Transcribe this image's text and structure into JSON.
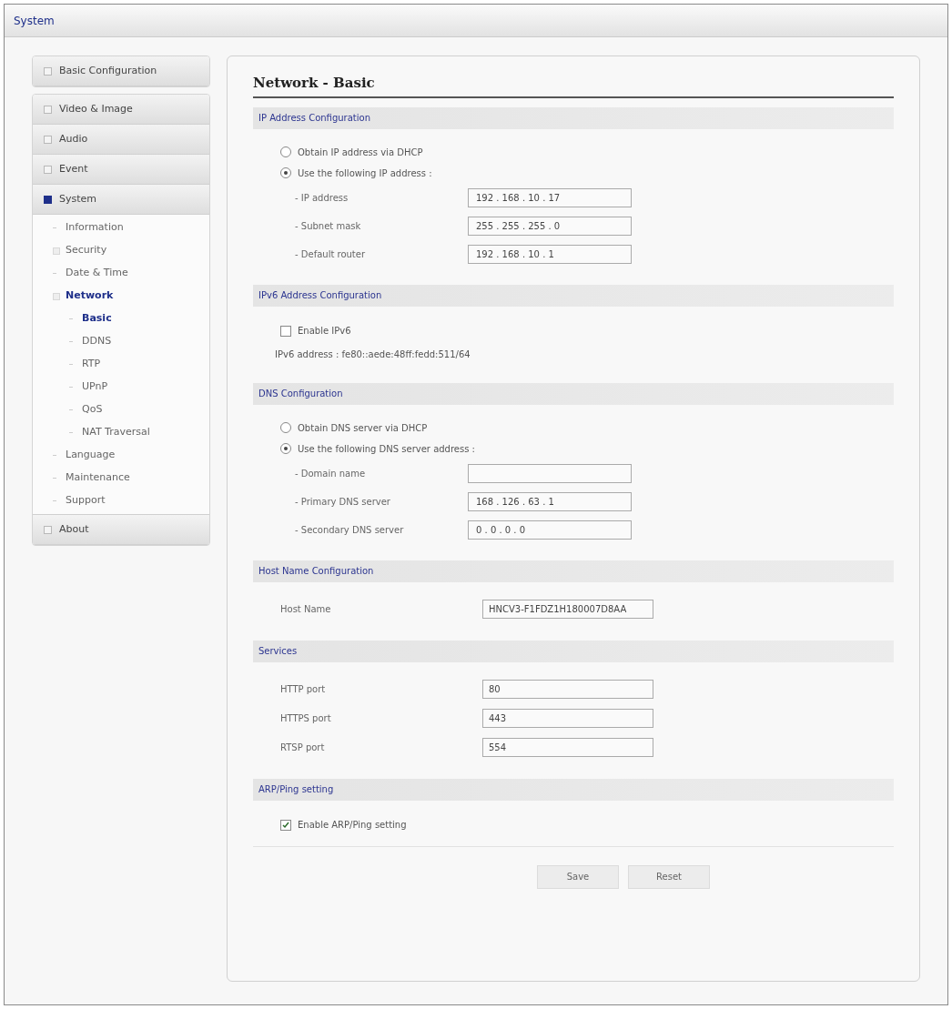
{
  "header": {
    "title": "System"
  },
  "sidebar": {
    "groups": [
      {
        "items": [
          {
            "label": "Basic Configuration",
            "expanded": false
          }
        ]
      },
      {
        "items": [
          {
            "label": "Video & Image",
            "expanded": false
          },
          {
            "label": "Audio",
            "expanded": false
          },
          {
            "label": "Event",
            "expanded": false
          },
          {
            "label": "System",
            "expanded": true,
            "children": [
              {
                "label": "Information",
                "selected": false
              },
              {
                "label": "Security",
                "selected": false,
                "expandable": true
              },
              {
                "label": "Date & Time",
                "selected": false
              },
              {
                "label": "Network",
                "selected": true,
                "expandable": true,
                "children": [
                  {
                    "label": "Basic",
                    "selected": true
                  },
                  {
                    "label": "DDNS",
                    "selected": false
                  },
                  {
                    "label": "RTP",
                    "selected": false
                  },
                  {
                    "label": "UPnP",
                    "selected": false
                  },
                  {
                    "label": "QoS",
                    "selected": false
                  },
                  {
                    "label": "NAT Traversal",
                    "selected": false
                  }
                ]
              },
              {
                "label": "Language",
                "selected": false
              },
              {
                "label": "Maintenance",
                "selected": false
              },
              {
                "label": "Support",
                "selected": false
              }
            ]
          },
          {
            "label": "About",
            "expanded": false
          }
        ]
      }
    ]
  },
  "page_title": "Network - Basic",
  "sections": [
    {
      "title": "IP Address Configuration",
      "rows": [
        {
          "kind": "radio",
          "label": "Obtain IP address via DHCP",
          "selected": false
        },
        {
          "kind": "radio",
          "label": "Use the following IP address :",
          "selected": true
        },
        {
          "kind": "field",
          "label": "- IP address",
          "value": "192 . 168 . 10 . 17"
        },
        {
          "kind": "field",
          "label": "- Subnet mask",
          "value": "255 . 255 . 255 . 0"
        },
        {
          "kind": "field",
          "label": "- Default router",
          "value": "192 . 168 . 10 . 1"
        }
      ]
    },
    {
      "title": "IPv6 Address Configuration",
      "rows": [
        {
          "kind": "checkbox",
          "label": "Enable IPv6",
          "checked": false
        },
        {
          "kind": "text",
          "label": "IPv6 address : fe80::aede:48ff:fedd:511/64"
        }
      ]
    },
    {
      "title": "DNS Configuration",
      "rows": [
        {
          "kind": "radio",
          "label": "Obtain DNS server via DHCP",
          "selected": false
        },
        {
          "kind": "radio",
          "label": "Use the following DNS server address :",
          "selected": true
        },
        {
          "kind": "field",
          "label": "- Domain name"
        },
        {
          "kind": "field",
          "label": "- Primary DNS server",
          "value": "168 . 126 . 63 . 1"
        },
        {
          "kind": "field",
          "label": "- Secondary DNS server",
          "value": "0 . 0 . 0 . 0"
        }
      ]
    },
    {
      "title": "Host Name Configuration",
      "rows": [
        {
          "kind": "plain-field",
          "label": "Host Name",
          "value": "HNCV3-F1FDZ1H180007D8AA"
        }
      ]
    },
    {
      "title": "Services",
      "rows": [
        {
          "kind": "plain-field",
          "label": "HTTP port",
          "value": "80"
        },
        {
          "kind": "plain-field",
          "label": "HTTPS port",
          "value": "443"
        },
        {
          "kind": "plain-field",
          "label": "RTSP port",
          "value": "554"
        }
      ]
    },
    {
      "title": "ARP/Ping setting",
      "rows": [
        {
          "kind": "checkbox",
          "label": "Enable ARP/Ping setting",
          "checked": true
        }
      ]
    }
  ],
  "buttons": [
    "Save",
    "Reset"
  ]
}
